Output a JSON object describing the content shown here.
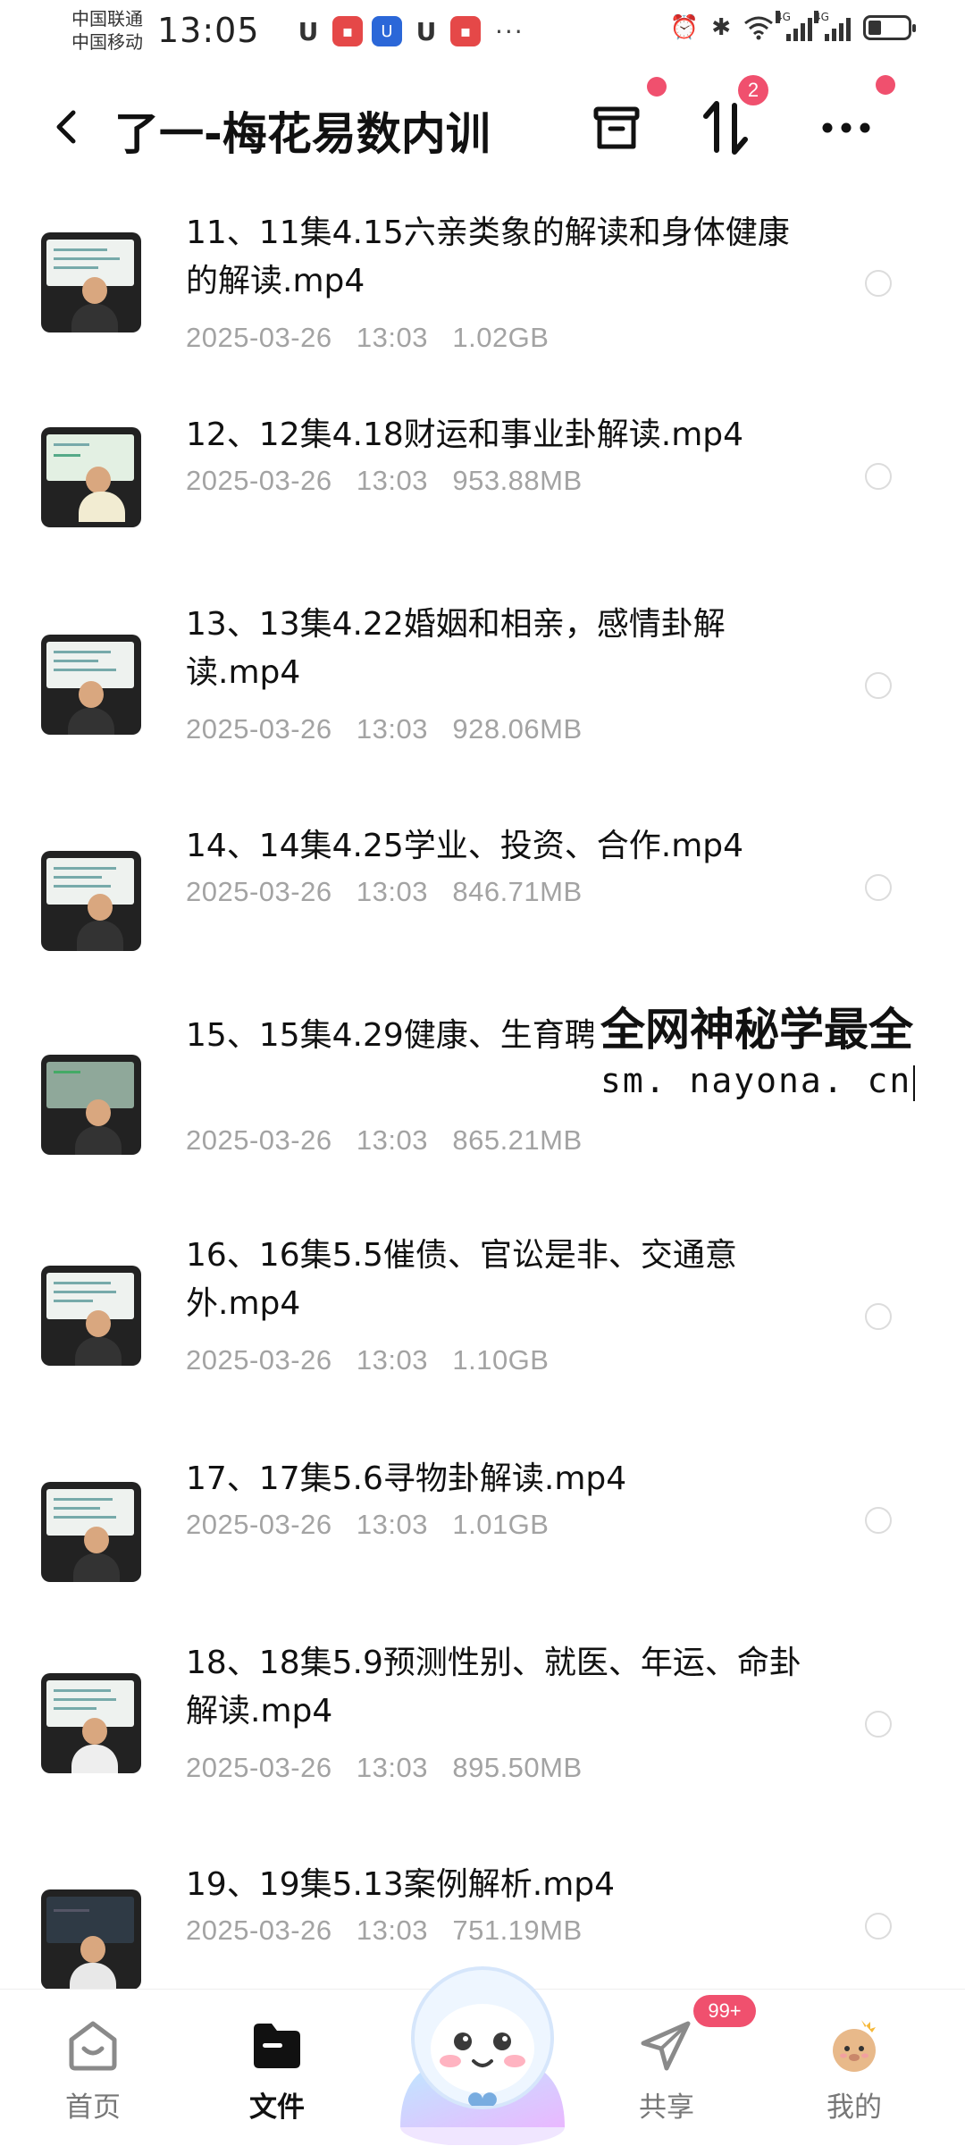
{
  "status_bar": {
    "carrier_1": "中国联通",
    "carrier_2": "中国移动",
    "time": "13:05",
    "network_1": "4G",
    "network_2": "4G",
    "more": "···"
  },
  "header": {
    "title": "了一-梅花易数内训",
    "sort_badge": "2"
  },
  "files": [
    {
      "name": "11、11集4.15六亲类象的解读和身体健康的解读.mp4",
      "date": "2025-03-26",
      "time": "13:03",
      "size": "1.02GB"
    },
    {
      "name": "12、12集4.18财运和事业卦解读.mp4",
      "date": "2025-03-26",
      "time": "13:03",
      "size": "953.88MB"
    },
    {
      "name": "13、13集4.22婚姻和相亲，感情卦解读.mp4",
      "date": "2025-03-26",
      "time": "13:03",
      "size": "928.06MB"
    },
    {
      "name": "14、14集4.25学业、投资、合作.mp4",
      "date": "2025-03-26",
      "time": "13:03",
      "size": "846.71MB"
    },
    {
      "name": "15、15集4.29健康、生育聘.mp4",
      "date": "2025-03-26",
      "time": "13:03",
      "size": "865.21MB"
    },
    {
      "name": "16、16集5.5催债、官讼是非、交通意外.mp4",
      "date": "2025-03-26",
      "time": "13:03",
      "size": "1.10GB"
    },
    {
      "name": "17、17集5.6寻物卦解读.mp4",
      "date": "2025-03-26",
      "time": "13:03",
      "size": "1.01GB"
    },
    {
      "name": "18、18集5.9预测性别、就医、年运、命卦解读.mp4",
      "date": "2025-03-26",
      "time": "13:03",
      "size": "895.50MB"
    },
    {
      "name": "19、19集5.13案例解析.mp4",
      "date": "2025-03-26",
      "time": "13:03",
      "size": "751.19MB"
    }
  ],
  "watermark": {
    "title": "全网神秘学最全",
    "url": "sm. nayona. cn"
  },
  "nav": {
    "home": "首页",
    "files": "文件",
    "share": "共享",
    "mine": "我的",
    "share_badge": "99+"
  },
  "colors": {
    "accent_red": "#f0506e",
    "meta_gray": "#a3a3a3",
    "ai_gradient_from": "#bfe7ff",
    "ai_gradient_to": "#e9b8ff"
  },
  "icons": [
    "back-icon",
    "trash-box-icon",
    "sort-icon",
    "more-icon",
    "home-icon",
    "folder-icon",
    "ai-assistant-icon",
    "send-icon",
    "avatar-icon"
  ]
}
